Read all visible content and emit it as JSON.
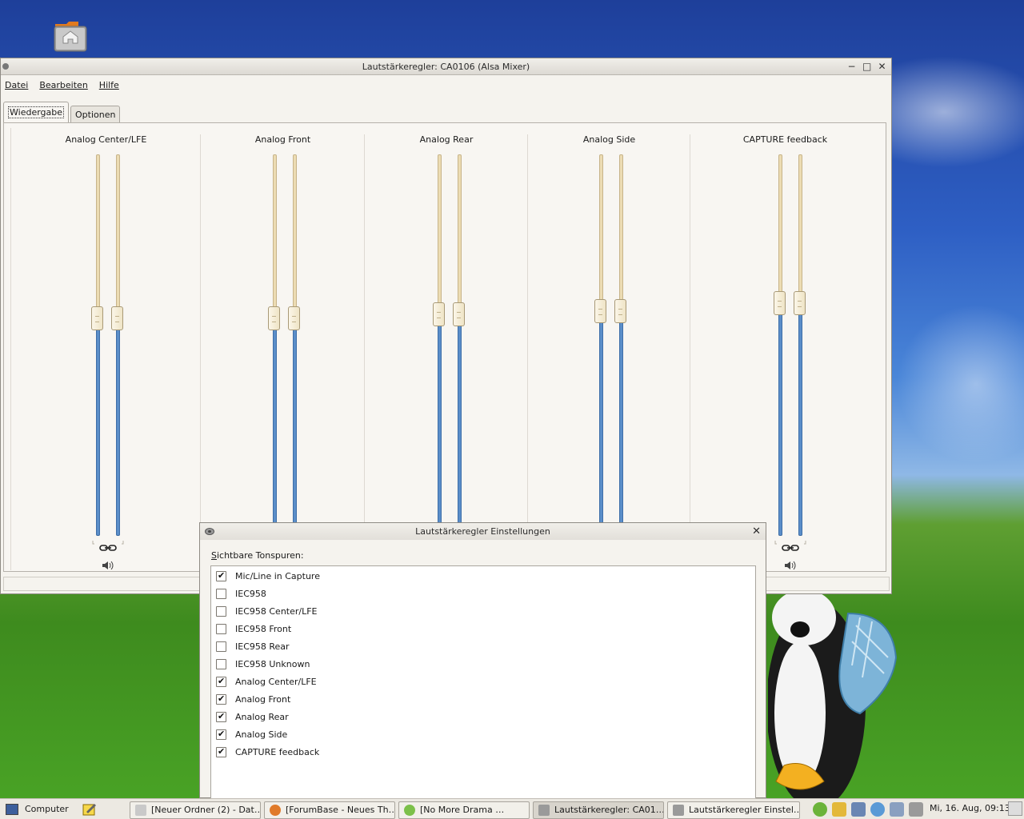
{
  "desktop": {
    "icons": [
      {
        "name": "home-folder",
        "label": ""
      }
    ]
  },
  "mixer_window": {
    "title": "Lautstärkeregler: CA0106 (Alsa Mixer)",
    "menu": [
      "Datei",
      "Bearbeiten",
      "Hilfe"
    ],
    "tabs": [
      {
        "label": "Wiedergabe",
        "active": true
      },
      {
        "label": "Optionen",
        "active": false
      }
    ],
    "channels": [
      {
        "name": "Analog Center/LFE",
        "left_level": 0.57,
        "right_level": 0.57,
        "locked": true
      },
      {
        "name": "Analog Front",
        "left_level": 0.57,
        "right_level": 0.57,
        "locked": true
      },
      {
        "name": "Analog Rear",
        "left_level": 0.58,
        "right_level": 0.58,
        "locked": true
      },
      {
        "name": "Analog Side",
        "left_level": 0.59,
        "right_level": 0.59,
        "locked": true
      },
      {
        "name": "CAPTURE feedback",
        "left_level": 0.61,
        "right_level": 0.61,
        "locked": true
      }
    ]
  },
  "settings_dialog": {
    "title": "Lautstärkeregler Einstellungen",
    "label_prefix": "S",
    "label_rest": "ichtbare Tonspuren:",
    "tracks": [
      {
        "label": "Mic/Line in Capture",
        "checked": true
      },
      {
        "label": "IEC958",
        "checked": false
      },
      {
        "label": "IEC958 Center/LFE",
        "checked": false
      },
      {
        "label": "IEC958 Front",
        "checked": false
      },
      {
        "label": "IEC958 Rear",
        "checked": false
      },
      {
        "label": "IEC958 Unknown",
        "checked": false
      },
      {
        "label": "Analog Center/LFE",
        "checked": true
      },
      {
        "label": "Analog Front",
        "checked": true
      },
      {
        "label": "Analog Rear",
        "checked": true
      },
      {
        "label": "Analog Side",
        "checked": true
      },
      {
        "label": "CAPTURE feedback",
        "checked": true
      }
    ]
  },
  "taskbar": {
    "start_label": "Computer",
    "buttons": [
      {
        "label": "[Neuer Ordner (2) - Dat…",
        "icon": "folder-icon",
        "active": false
      },
      {
        "label": "[ForumBase - Neues Th…",
        "icon": "firefox-icon",
        "active": false
      },
      {
        "label": "[No More Drama        …",
        "icon": "amarok-icon",
        "active": false
      },
      {
        "label": "Lautstärkeregler: CA01…",
        "icon": "mixer-icon",
        "active": true
      },
      {
        "label": "Lautstärkeregler Einstel…",
        "icon": "mixer-icon",
        "active": false
      }
    ],
    "clock": "Mi, 16. Aug, 09:13"
  },
  "colors": {
    "slider_fill": "#5b8ec9",
    "slider_track": "#ecdcb3",
    "window_bg": "#f5f3ee"
  }
}
